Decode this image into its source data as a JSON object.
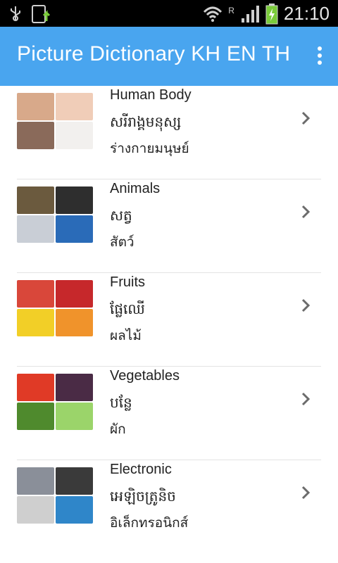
{
  "status": {
    "time": "21:10",
    "roaming": "R"
  },
  "app": {
    "title": "Picture Dictionary KH EN TH"
  },
  "items": [
    {
      "en": "Human Body",
      "kh": "សរីរាង្គមនុស្ស",
      "th": "ร่างกายมนุษย์",
      "icon": "human-body-thumbnail",
      "colors": [
        "#d8a98a",
        "#f0cdb8",
        "#8a6a5a",
        "#f2f0ee"
      ]
    },
    {
      "en": "Animals",
      "kh": "សត្វ",
      "th": "สัตว์",
      "icon": "animals-thumbnail",
      "colors": [
        "#6b5a3e",
        "#2e2e2e",
        "#c9ced6",
        "#2a6bb8"
      ]
    },
    {
      "en": "Fruits",
      "kh": "ផ្លែឈើ",
      "th": "ผลไม้",
      "icon": "fruits-thumbnail",
      "colors": [
        "#d9473a",
        "#c6282b",
        "#f2cf27",
        "#f0932b"
      ]
    },
    {
      "en": "Vegetables",
      "kh": "បន្លែ",
      "th": "ผัก",
      "icon": "vegetables-thumbnail",
      "colors": [
        "#e03a26",
        "#4a2b45",
        "#4f8a2d",
        "#9bd46a"
      ]
    },
    {
      "en": "Electronic",
      "kh": "អេឡិចត្រូនិច",
      "th": "อิเล็กทรอนิกส์",
      "icon": "electronics-thumbnail",
      "colors": [
        "#8a8f99",
        "#3a3a3a",
        "#cfcfcf",
        "#2f86c9"
      ]
    }
  ]
}
